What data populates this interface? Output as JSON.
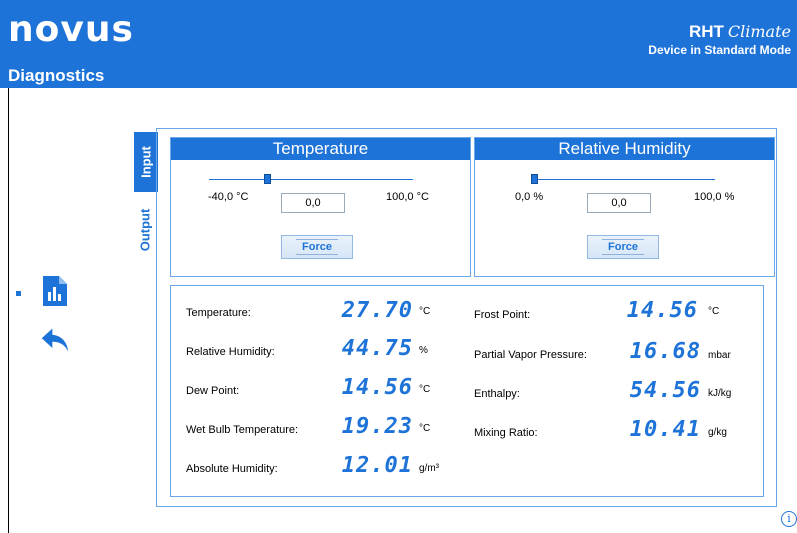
{
  "header": {
    "logo": "novus",
    "page_title": "Diagnostics",
    "model": "RHT",
    "model_script": "Climate",
    "mode": "Device in Standard Mode"
  },
  "tabs": [
    {
      "label": "Input",
      "active": true
    },
    {
      "label": "Output",
      "active": false
    }
  ],
  "controls": {
    "temperature": {
      "title": "Temperature",
      "min_label": "-40,0 °C",
      "max_label": "100,0 °C",
      "value": "0,0",
      "force_label": "Force",
      "slider_fraction": 0.286
    },
    "humidity": {
      "title": "Relative Humidity",
      "min_label": "0,0 %",
      "max_label": "100,0 %",
      "value": "0,0",
      "force_label": "Force",
      "slider_fraction": 0.0
    }
  },
  "readings": {
    "temperature": {
      "label": "Temperature:",
      "value": "27.70",
      "unit": "°C"
    },
    "relative_humidity": {
      "label": "Relative Humidity:",
      "value": "44.75",
      "unit": "%"
    },
    "dew_point": {
      "label": "Dew Point:",
      "value": "14.56",
      "unit": "°C"
    },
    "wet_bulb": {
      "label": "Wet Bulb Temperature:",
      "value": "19.23",
      "unit": "°C"
    },
    "absolute_humidity": {
      "label": "Absolute Humidity:",
      "value": "12.01",
      "unit": "g/m³"
    },
    "frost_point": {
      "label": "Frost Point:",
      "value": "14.56",
      "unit": "°C"
    },
    "partial_vapor_pressure": {
      "label": "Partial Vapor Pressure:",
      "value": "16.68",
      "unit": "mbar"
    },
    "enthalpy": {
      "label": "Enthalpy:",
      "value": "54.56",
      "unit": "kJ/kg"
    },
    "mixing_ratio": {
      "label": "Mixing Ratio:",
      "value": "10.41",
      "unit": "g/kg"
    }
  },
  "sidebar": {
    "icons": [
      "report-icon",
      "back-arrow-icon"
    ]
  },
  "info": {
    "glyph": "i"
  },
  "colors": {
    "accent": "#1E73D8",
    "border": "#6aa7e6"
  }
}
